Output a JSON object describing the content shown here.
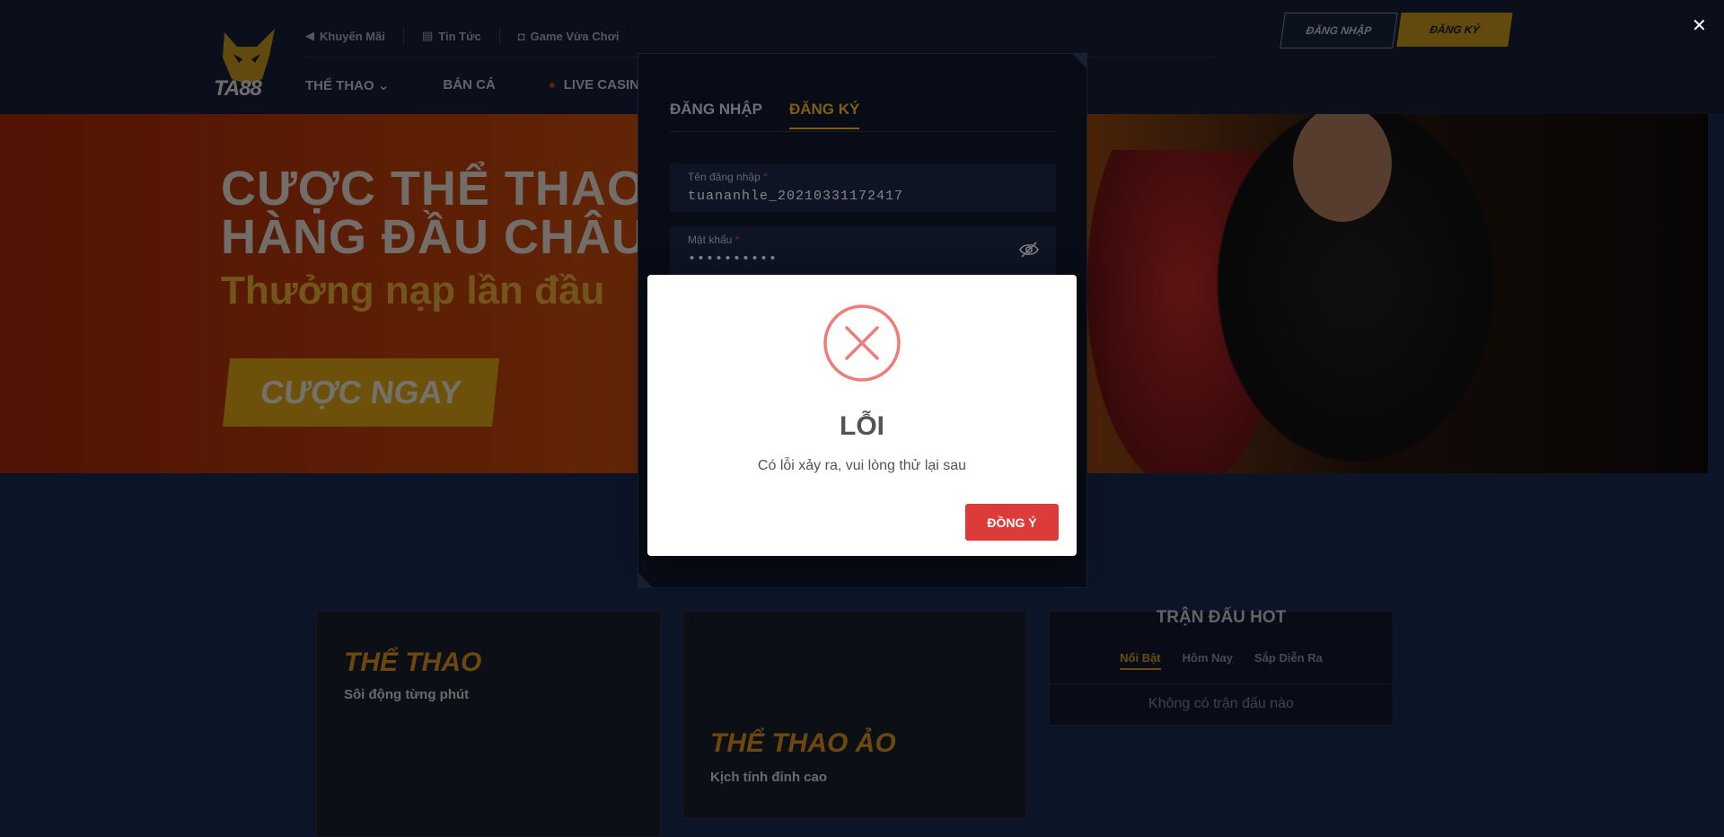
{
  "header": {
    "logo_text": "TA88",
    "top_nav": [
      {
        "label": "Khuyến Mãi",
        "icon": "speaker-icon"
      },
      {
        "label": "Tin Tức",
        "icon": "document-icon"
      },
      {
        "label": "Game Vừa Chơi",
        "icon": "gamepad-icon"
      }
    ],
    "main_nav": [
      {
        "label": "THỂ THAO"
      },
      {
        "label": "BẮN CÁ"
      },
      {
        "label": "LIVE CASINO"
      }
    ],
    "login_label": "ĐĂNG NHẬP",
    "register_label": "ĐĂNG KÝ"
  },
  "banner": {
    "line1": "CƯỢC THỂ THAO",
    "line2": "HÀNG ĐẦU CHÂU",
    "line3": "Thưởng nạp lần đầu",
    "cta": "CƯỢC NGAY"
  },
  "cards": [
    {
      "title": "THỂ THAO",
      "subtitle": "Sôi động từng phút"
    },
    {
      "title": "THỂ THAO ẢO",
      "subtitle": "Kịch tính đỉnh cao"
    }
  ],
  "hot_matches": {
    "title": "TRẬN ĐẤU HOT",
    "tabs": [
      "Nổi Bật",
      "Hôm Nay",
      "Sắp Diễn Ra"
    ],
    "empty": "Không có trận đấu nào"
  },
  "auth_modal": {
    "tab_login": "ĐĂNG NHẬP",
    "tab_register": "ĐĂNG KÝ",
    "username_label": "Tên đăng nhập",
    "username_value": "tuananhle_20210331172417",
    "password_label": "Mật khẩu",
    "password_value": "••••••••••",
    "required_mark": "*"
  },
  "error_dialog": {
    "title": "LỖI",
    "message": "Có lỗi xảy ra, vui lòng thử lại sau",
    "button": "ĐỒNG Ý"
  },
  "close_symbol": "✕",
  "colors": {
    "accent": "#e6a922",
    "error_red": "#dd3a3a",
    "icon_red": "#f07b7b",
    "page_bg": "#0c1427"
  }
}
